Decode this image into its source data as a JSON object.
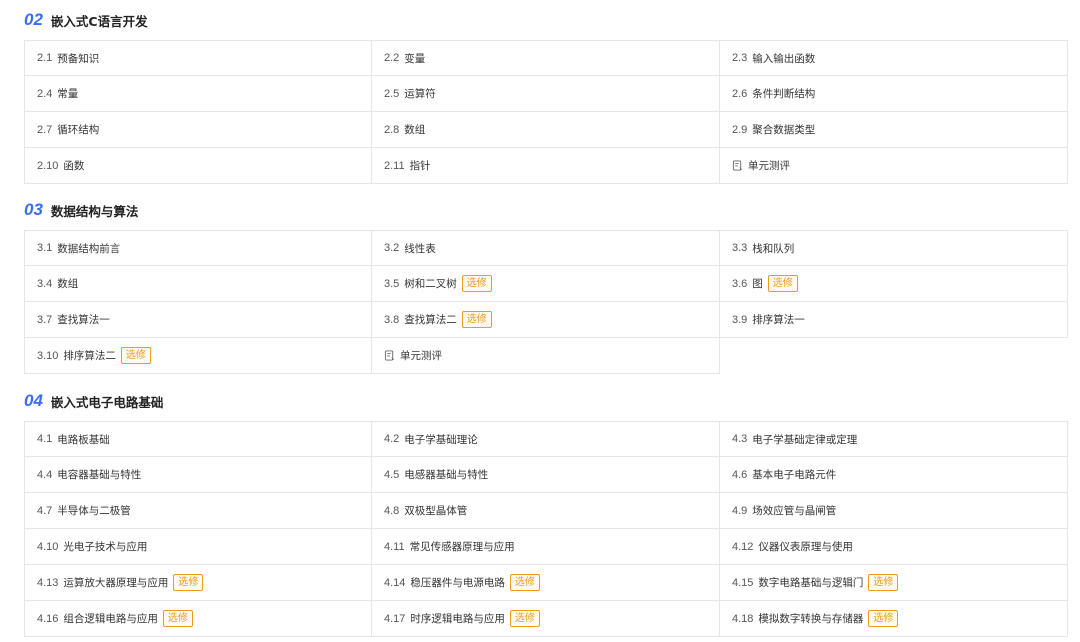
{
  "elective_label": "选修",
  "quiz_label": "单元测评",
  "sections": [
    {
      "num": "02",
      "title": "嵌入式C语言开发",
      "lessons": [
        {
          "num": "2.1",
          "title": "预备知识"
        },
        {
          "num": "2.2",
          "title": "变量"
        },
        {
          "num": "2.3",
          "title": "输入输出函数"
        },
        {
          "num": "2.4",
          "title": "常量"
        },
        {
          "num": "2.5",
          "title": "运算符"
        },
        {
          "num": "2.6",
          "title": "条件判断结构"
        },
        {
          "num": "2.7",
          "title": "循环结构"
        },
        {
          "num": "2.8",
          "title": "数组"
        },
        {
          "num": "2.9",
          "title": "聚合数据类型"
        },
        {
          "num": "2.10",
          "title": "函数"
        },
        {
          "num": "2.11",
          "title": "指针"
        },
        {
          "quiz": true
        }
      ]
    },
    {
      "num": "03",
      "title": "数据结构与算法",
      "lessons": [
        {
          "num": "3.1",
          "title": "数据结构前言"
        },
        {
          "num": "3.2",
          "title": "线性表"
        },
        {
          "num": "3.3",
          "title": "栈和队列"
        },
        {
          "num": "3.4",
          "title": "数组"
        },
        {
          "num": "3.5",
          "title": "树和二叉树",
          "elective": true
        },
        {
          "num": "3.6",
          "title": "图",
          "elective": true
        },
        {
          "num": "3.7",
          "title": "查找算法一"
        },
        {
          "num": "3.8",
          "title": "查找算法二",
          "elective": true
        },
        {
          "num": "3.9",
          "title": "排序算法一"
        },
        {
          "num": "3.10",
          "title": "排序算法二",
          "elective": true
        },
        {
          "quiz": true
        }
      ]
    },
    {
      "num": "04",
      "title": "嵌入式电子电路基础",
      "lessons": [
        {
          "num": "4.1",
          "title": "电路板基础"
        },
        {
          "num": "4.2",
          "title": "电子学基础理论"
        },
        {
          "num": "4.3",
          "title": "电子学基础定律或定理"
        },
        {
          "num": "4.4",
          "title": "电容器基础与特性"
        },
        {
          "num": "4.5",
          "title": "电感器基础与特性"
        },
        {
          "num": "4.6",
          "title": "基本电子电路元件"
        },
        {
          "num": "4.7",
          "title": "半导体与二极管"
        },
        {
          "num": "4.8",
          "title": "双极型晶体管"
        },
        {
          "num": "4.9",
          "title": "场效应管与晶闸管"
        },
        {
          "num": "4.10",
          "title": "光电子技术与应用"
        },
        {
          "num": "4.11",
          "title": "常见传感器原理与应用"
        },
        {
          "num": "4.12",
          "title": "仪器仪表原理与使用"
        },
        {
          "num": "4.13",
          "title": "运算放大器原理与应用",
          "elective": true
        },
        {
          "num": "4.14",
          "title": "稳压器件与电源电路",
          "elective": true
        },
        {
          "num": "4.15",
          "title": "数字电路基础与逻辑门",
          "elective": true
        },
        {
          "num": "4.16",
          "title": "组合逻辑电路与应用",
          "elective": true
        },
        {
          "num": "4.17",
          "title": "时序逻辑电路与应用",
          "elective": true
        },
        {
          "num": "4.18",
          "title": "模拟数字转换与存储器",
          "elective": true
        }
      ]
    }
  ]
}
